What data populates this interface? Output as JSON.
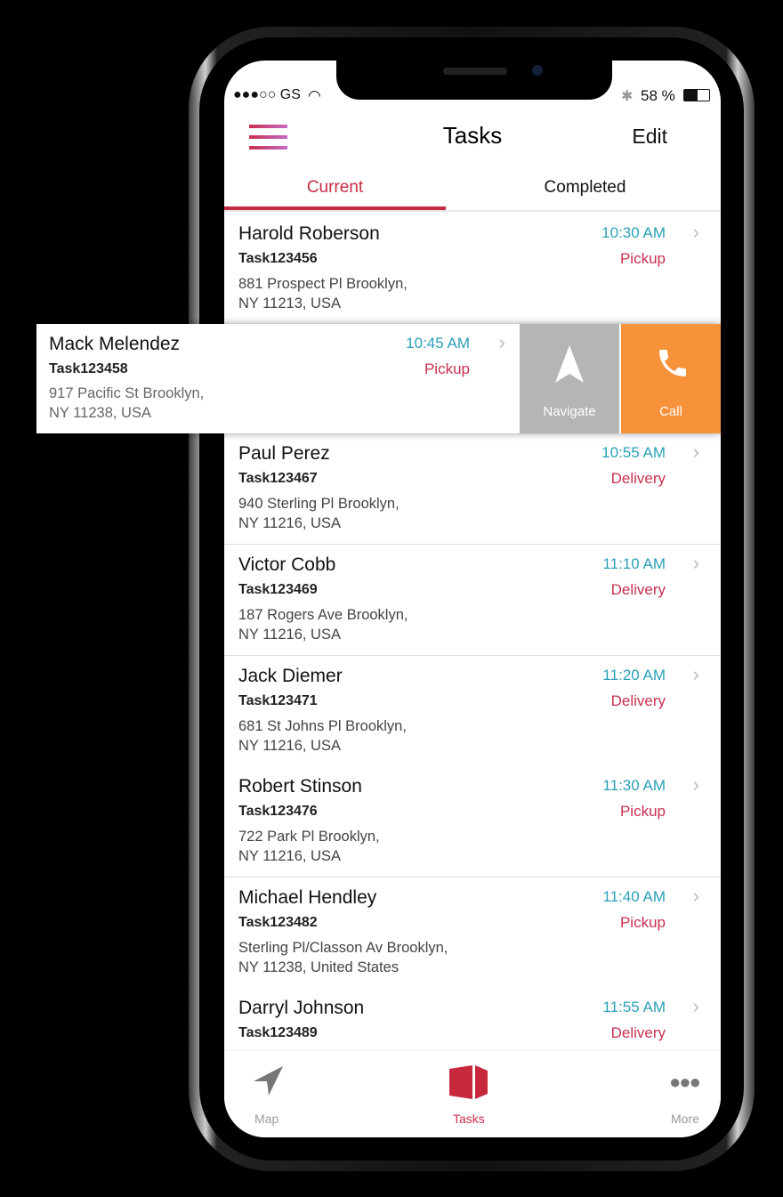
{
  "status": {
    "carrier": "●●●○○ GS",
    "battery": "58 %"
  },
  "header": {
    "title": "Tasks",
    "edit_label": "Edit"
  },
  "tabs": [
    {
      "label": "Current",
      "active": true
    },
    {
      "label": "Completed",
      "active": false
    }
  ],
  "colors": {
    "accent": "#c62d45",
    "time": "#2a9fb8",
    "call": "#f7913a",
    "navigate": "#b5b5b5"
  },
  "tasks": [
    {
      "name": "Harold Roberson",
      "id": "Task123456",
      "address1": "881 Prospect Pl Brooklyn,",
      "address2": "NY 11213, USA",
      "time": "10:30 AM",
      "type": "Pickup"
    },
    {
      "name": "Mack Melendez",
      "id": "Task123458",
      "address1": "917 Pacific St Brooklyn,",
      "address2": "NY 11238, USA",
      "time": "10:45 AM",
      "type": "Pickup"
    },
    {
      "name": "Paul Perez",
      "id": "Task123467",
      "address1": "940 Sterling Pl Brooklyn,",
      "address2": "NY 11216, USA",
      "time": "10:55 AM",
      "type": "Delivery"
    },
    {
      "name": "Victor Cobb",
      "id": "Task123469",
      "address1": "187 Rogers Ave Brooklyn,",
      "address2": "NY 11216, USA",
      "time": "11:10 AM",
      "type": "Delivery"
    },
    {
      "name": "Jack Diemer",
      "id": "Task123471",
      "address1": "681 St Johns Pl Brooklyn,",
      "address2": "NY 11216, USA",
      "time": "11:20 AM",
      "type": "Delivery"
    },
    {
      "name": "Robert Stinson",
      "id": "Task123476",
      "address1": "722 Park Pl Brooklyn,",
      "address2": "NY 11216, USA",
      "time": "11:30 AM",
      "type": "Pickup"
    },
    {
      "name": "Michael Hendley",
      "id": "Task123482",
      "address1": "Sterling Pl/Classon Av Brooklyn,",
      "address2": "NY 11238, United States",
      "time": "11:40 AM",
      "type": "Pickup"
    },
    {
      "name": "Darryl Johnson",
      "id": "Task123489",
      "address1": "",
      "address2": "",
      "time": "11:55 AM",
      "type": "Delivery"
    }
  ],
  "swipe_actions": {
    "navigate": "Navigate",
    "call": "Call"
  },
  "tabbar": [
    {
      "label": "Map",
      "icon": "navigation-arrow-icon"
    },
    {
      "label": "Tasks",
      "icon": "box-icon",
      "active": true
    },
    {
      "label": "More",
      "icon": "more-dots-icon"
    }
  ]
}
